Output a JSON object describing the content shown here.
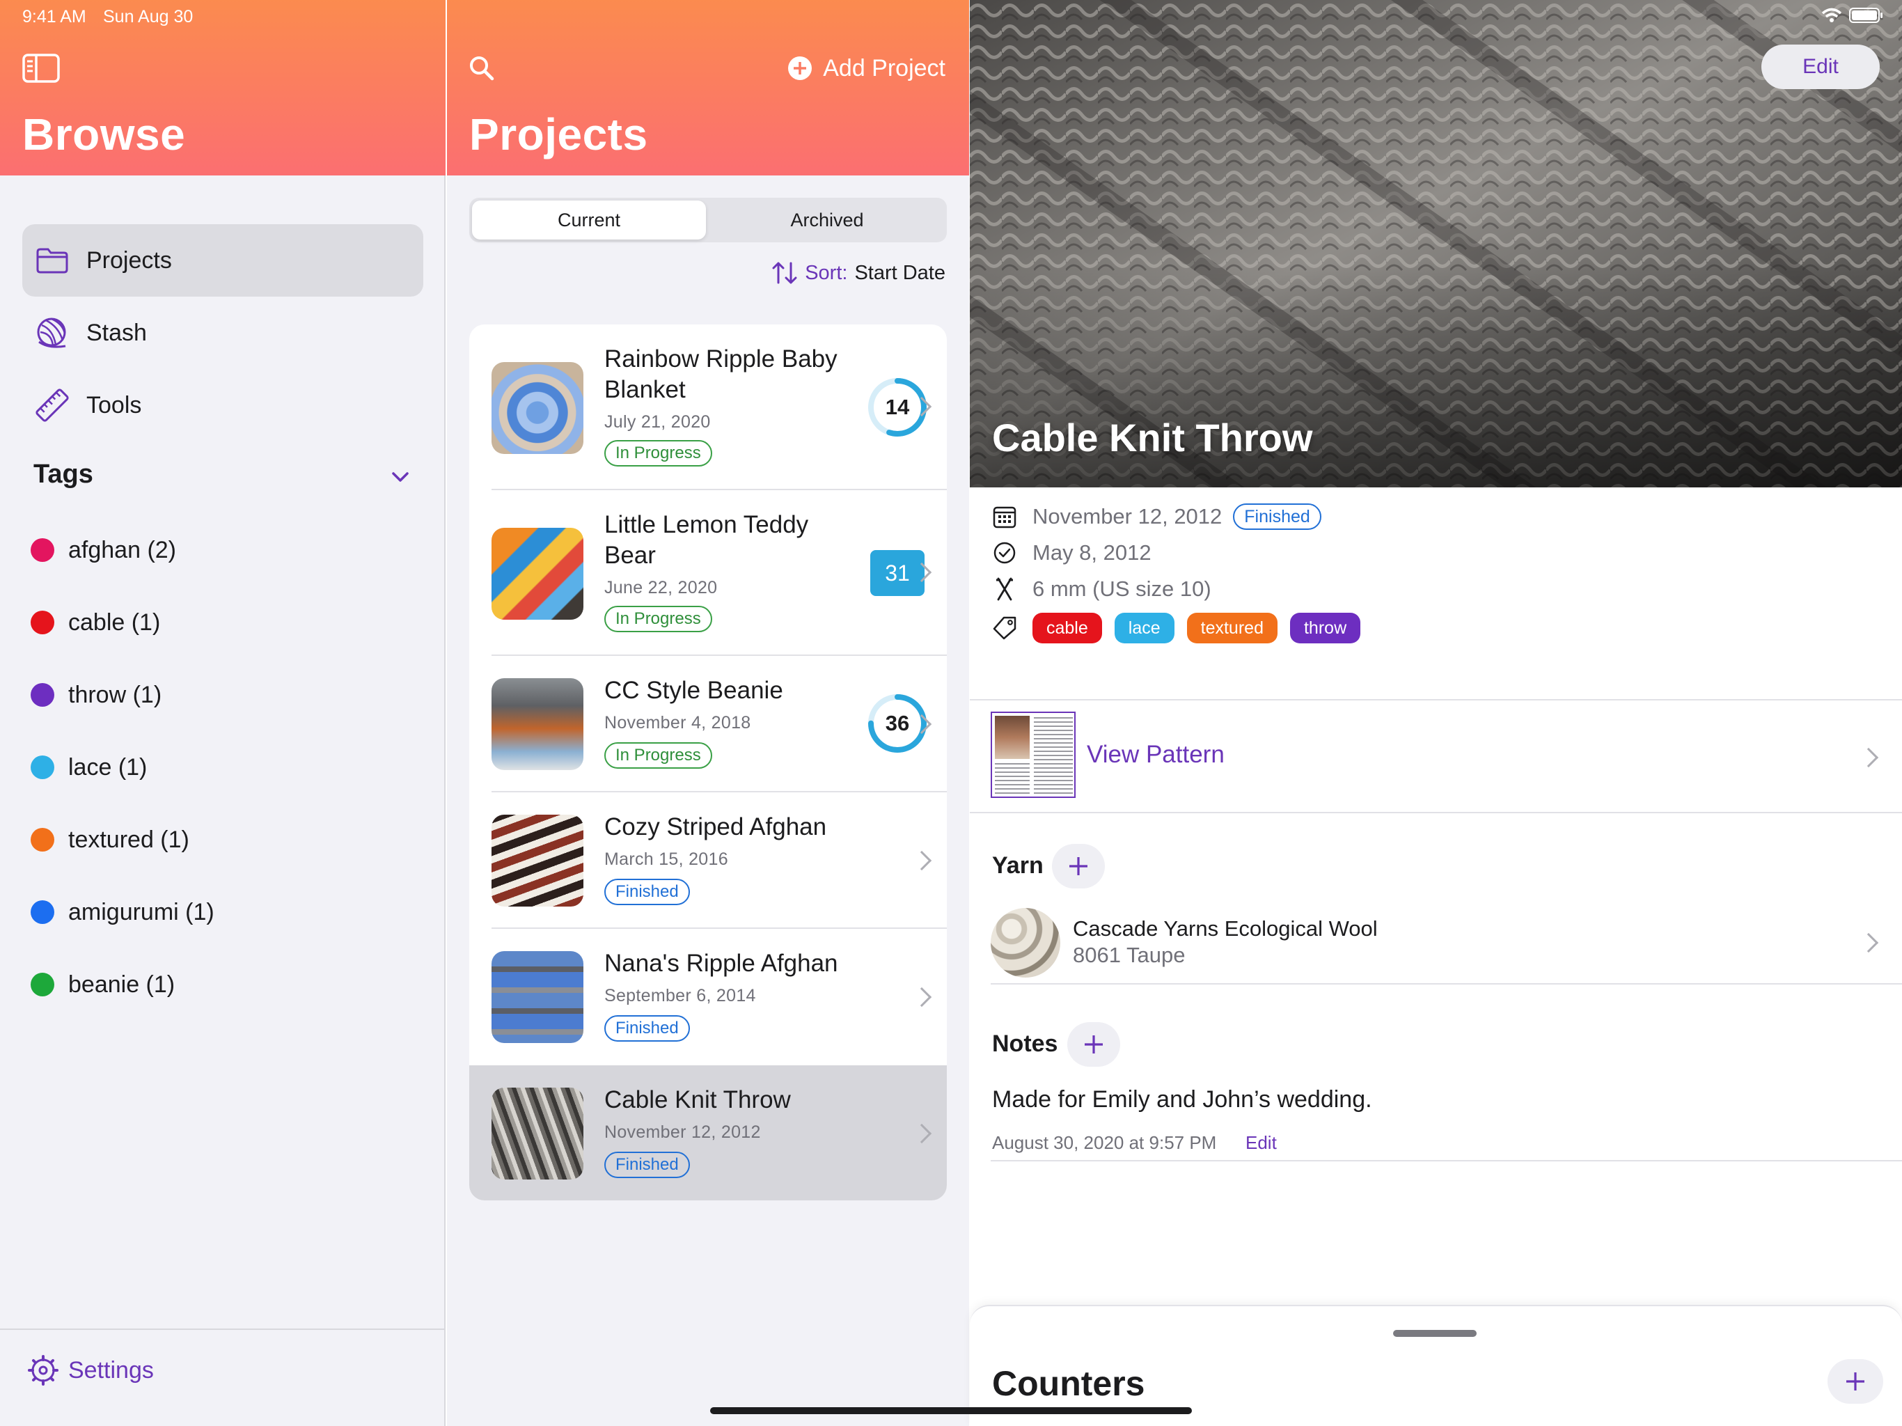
{
  "status_bar": {
    "time": "9:41 AM",
    "date": "Sun Aug 30"
  },
  "sidebar": {
    "title": "Browse",
    "items": [
      {
        "label": "Projects",
        "icon": "folder-icon"
      },
      {
        "label": "Stash",
        "icon": "yarn-ball-icon"
      },
      {
        "label": "Tools",
        "icon": "ruler-icon"
      }
    ],
    "tags_header": "Tags",
    "tags": [
      {
        "label": "afghan (2)",
        "color": "#e3155f"
      },
      {
        "label": "cable (1)",
        "color": "#e5141c"
      },
      {
        "label": "throw (1)",
        "color": "#6d2ec0"
      },
      {
        "label": "lace (1)",
        "color": "#2eb0e6"
      },
      {
        "label": "textured (1)",
        "color": "#f2701a"
      },
      {
        "label": "amigurumi (1)",
        "color": "#1c6ef0"
      },
      {
        "label": "beanie (1)",
        "color": "#1da83a"
      }
    ],
    "settings_label": "Settings",
    "accent": "#6a35b8"
  },
  "list": {
    "add_label": "Add Project",
    "title": "Projects",
    "segments": [
      "Current",
      "Archived"
    ],
    "sort_prefix": "Sort:",
    "sort_value": "Start Date",
    "projects": [
      {
        "name": "Rainbow Ripple Baby Blanket",
        "date": "July 21, 2020",
        "status": "In Progress",
        "counter": "14",
        "counter_style": "ring",
        "progress": 0.55
      },
      {
        "name": "Little Lemon Teddy Bear",
        "date": "June 22, 2020",
        "status": "In Progress",
        "counter": "31",
        "counter_style": "square"
      },
      {
        "name": "CC Style Beanie",
        "date": "November 4, 2018",
        "status": "In Progress",
        "counter": "36",
        "counter_style": "ring",
        "progress": 0.75
      },
      {
        "name": "Cozy Striped Afghan",
        "date": "March 15, 2016",
        "status": "Finished"
      },
      {
        "name": "Nana's Ripple Afghan",
        "date": "September 6, 2014",
        "status": "Finished"
      },
      {
        "name": "Cable Knit Throw",
        "date": "November 12, 2012",
        "status": "Finished"
      }
    ]
  },
  "detail": {
    "edit_label": "Edit",
    "title": "Cable Knit Throw",
    "end_date": "November 12, 2012",
    "status": "Finished",
    "start_date": "May 8, 2012",
    "needle": "6 mm (US size 10)",
    "tags": [
      {
        "label": "cable",
        "color": "#e5141c"
      },
      {
        "label": "lace",
        "color": "#2eb0e6"
      },
      {
        "label": "textured",
        "color": "#f2701a"
      },
      {
        "label": "throw",
        "color": "#6d2ec0"
      }
    ],
    "view_pattern": "View Pattern",
    "yarn_title": "Yarn",
    "yarn_name": "Cascade Yarns Ecological Wool",
    "yarn_color": "8061 Taupe",
    "notes_title": "Notes",
    "note_text": "Made for Emily and John’s wedding.",
    "note_meta": "August 30, 2020 at 9:57 PM",
    "note_edit": "Edit",
    "counters_title": "Counters"
  }
}
